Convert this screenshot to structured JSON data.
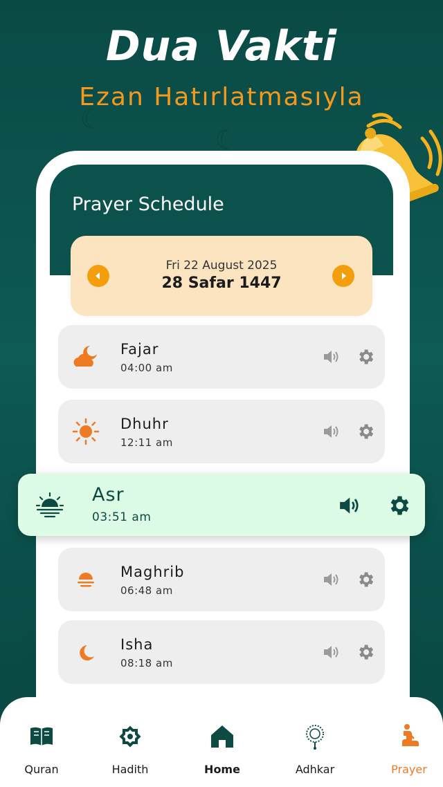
{
  "promo": {
    "headline": "Dua Vakti",
    "subline": "Ezan Hatırlatmasıyla"
  },
  "screen": {
    "title": "Prayer Schedule"
  },
  "date": {
    "gregorian": "Fri 22 August 2025",
    "hijri": "28 Safar 1447"
  },
  "prayers": [
    {
      "name": "Fajar",
      "time": "04:00 am",
      "icon": "cloud-moon-icon"
    },
    {
      "name": "Dhuhr",
      "time": "12:11 am",
      "icon": "sun-icon"
    },
    {
      "name": "Asr",
      "time": "03:51 am",
      "icon": "sunset-icon",
      "active": true
    },
    {
      "name": "Maghrib",
      "time": "06:48 am",
      "icon": "sunset-small-icon"
    },
    {
      "name": "Isha",
      "time": "08:18 am",
      "icon": "crescent-moon-icon"
    }
  ],
  "nav": [
    {
      "label": "Quran",
      "icon": "quran-book-icon"
    },
    {
      "label": "Hadith",
      "icon": "octagram-star-icon"
    },
    {
      "label": "Home",
      "icon": "home-icon",
      "active": true
    },
    {
      "label": "Adhkar",
      "icon": "tasbih-beads-icon"
    },
    {
      "label": "Prayer",
      "icon": "praying-person-icon"
    }
  ],
  "colors": {
    "background": "#0b524c",
    "accent": "#f59e0b",
    "highlight": "#dcfce6",
    "prayer_orange": "#ef7a24"
  }
}
